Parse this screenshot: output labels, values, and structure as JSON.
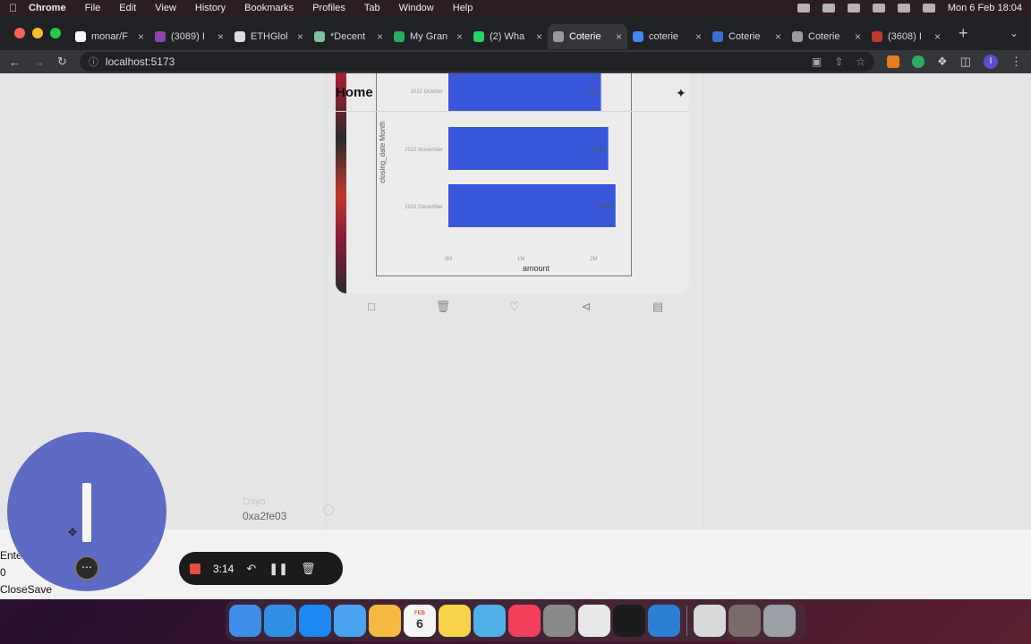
{
  "menubar": {
    "app_name": "Chrome",
    "items": [
      "File",
      "Edit",
      "View",
      "History",
      "Bookmarks",
      "Profiles",
      "Tab",
      "Window",
      "Help"
    ],
    "clock": "Mon 6 Feb  18:04"
  },
  "tabs": [
    {
      "label": "monar/F",
      "color": "#ffffff"
    },
    {
      "label": "(3089) I",
      "color": "#8e44ad"
    },
    {
      "label": "ETHGlol",
      "color": "#dddddd"
    },
    {
      "label": "*Decent",
      "color": "#7fbf9f"
    },
    {
      "label": "My Gran",
      "color": "#27ae60"
    },
    {
      "label": "(2) Wha",
      "color": "#25d366"
    },
    {
      "label": "Coterie",
      "color": "#9a9a9a",
      "active": true
    },
    {
      "label": "coterie",
      "color": "#4285f4"
    },
    {
      "label": "Coterie",
      "color": "#3b6fd6"
    },
    {
      "label": "Coterie",
      "color": "#9a9a9a"
    },
    {
      "label": "(3608) I",
      "color": "#c0392b"
    }
  ],
  "address_bar": {
    "url": "localhost:5173"
  },
  "page": {
    "home_title": "Home",
    "user": {
      "name": "Dayo",
      "address": "0xa2fe03"
    },
    "bottom": {
      "enter_label": "Ente",
      "value": "0",
      "close_save": "CloseSave"
    }
  },
  "recorder": {
    "time": "3:14"
  },
  "chart_data": {
    "type": "bar",
    "orientation": "horizontal",
    "categories": [
      "2022 October",
      "2022 November",
      "2022 December"
    ],
    "values": [
      2.1,
      2.2,
      2.3
    ],
    "data_labels": [
      "2.1M",
      "2.2M",
      "2.3M"
    ],
    "xlabel": "amount",
    "ylabel": "closing_date Month",
    "x_ticks": [
      "0M",
      "1M",
      "2M"
    ],
    "xlim": [
      0,
      2.5
    ],
    "bar_color": "#3a56d9"
  },
  "dock": {
    "apps": [
      {
        "name": "Finder",
        "color": "#3d8ee8"
      },
      {
        "name": "Safari",
        "color": "#2f8fe5"
      },
      {
        "name": "App Store",
        "color": "#1e88f2"
      },
      {
        "name": "Mail",
        "color": "#4aa3f0"
      },
      {
        "name": "Photos",
        "color": "#f5b942"
      },
      {
        "name": "Calendar",
        "color": "#f5f5f5",
        "text": "6",
        "badge": "FEB"
      },
      {
        "name": "Notes",
        "color": "#f6d34a"
      },
      {
        "name": "Freeform",
        "color": "#4fb0e8"
      },
      {
        "name": "Music",
        "color": "#f2405c"
      },
      {
        "name": "System Settings",
        "color": "#8a8a8a"
      },
      {
        "name": "Chrome",
        "color": "#e8e8e8"
      },
      {
        "name": "Terminal",
        "color": "#1c1c1c"
      },
      {
        "name": "VS Code",
        "color": "#2a7fd4"
      },
      {
        "name": "Preview",
        "color": "#d9d9d9"
      },
      {
        "name": "Chrome App",
        "color": "#7a6a6a"
      },
      {
        "name": "Trash",
        "color": "#9aa0a6"
      }
    ]
  }
}
